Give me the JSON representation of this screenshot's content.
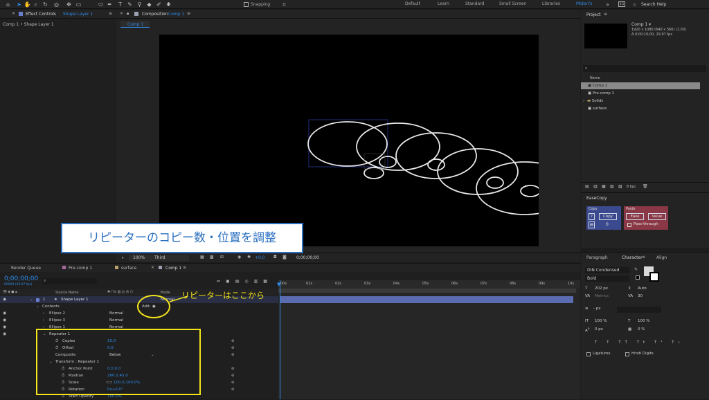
{
  "toolbar": {
    "snapping_label": "Snapping",
    "workspaces": [
      "Default",
      "Learn",
      "Standard",
      "Small Screen",
      "Libraries",
      "Midori's"
    ],
    "active_workspace": "Midori's",
    "search_placeholder": "Search Help"
  },
  "effect_controls": {
    "title": "Effect Controls",
    "layer": "Shape Layer 1",
    "breadcrumb": "Comp 1 • Shape Layer 1"
  },
  "composition": {
    "title": "Composition",
    "name": "Comp 1",
    "tab": "Comp 1",
    "zoom": "100%",
    "resolution": "Third",
    "exposure": "+0.0",
    "timecode": "0;00;00;00"
  },
  "overlay": {
    "banner": "リピーターのコピー数・位置を調整",
    "callout": "リピーターはここから"
  },
  "project": {
    "title": "Project",
    "comp_name": "Comp 1 ▾",
    "comp_info": [
      "1920 x 1080  (640 x 360) (1.00)",
      "Δ 0;00;10;00, 29.97 fps"
    ],
    "search_placeholder": "",
    "column_name": "Name",
    "items": [
      {
        "name": "Comp 1",
        "type": "comp",
        "selected": true
      },
      {
        "name": "Pre-comp 1",
        "type": "comp",
        "selected": false
      },
      {
        "name": "Solids",
        "type": "folder",
        "selected": false
      },
      {
        "name": "surface",
        "type": "comp",
        "selected": false
      }
    ],
    "bpc": "8 bpc"
  },
  "easecopy": {
    "title": "EaseCopy",
    "copy_group": "Copy",
    "copy_button": "Copy",
    "copy_value": "0",
    "paste_group": "Paste",
    "ease_button": "Ease",
    "value_button": "Value",
    "passthrough": "Pass-through"
  },
  "character": {
    "tabs": [
      "Paragraph",
      "Character",
      "Align"
    ],
    "active_tab": "Character",
    "font": "DIN Condensed",
    "style": "Bold",
    "size": "202 px",
    "leading": "Auto",
    "kerning": "Metrics",
    "tracking": "30",
    "stroke": "- px",
    "vscale": "100 %",
    "hscale": "100 %",
    "baseline": "0 px",
    "tsume": "0 %",
    "ligatures": "Ligatures",
    "hindi": "Hindi Digits"
  },
  "timeline": {
    "tabs": [
      "Render Queue",
      "Pre-comp 1",
      "surface",
      "Comp 1"
    ],
    "active_tab": "Comp 1",
    "timecode": "0;00;00;00",
    "fps": "00000 (29.97 fps)",
    "col_source": "Source Name",
    "col_mode": "Mode",
    "ruler": [
      "00s",
      "01s",
      "02s",
      "03s",
      "04s",
      "05s",
      "06s",
      "07s",
      "08s",
      "09s",
      "10s"
    ],
    "layer_number": "1",
    "layer_name": "Shape Layer 1",
    "layer_mode": "Normal",
    "contents": "Contents",
    "add_label": "Add:",
    "ellipses": [
      {
        "name": "Ellipse 2",
        "mode": "Normal"
      },
      {
        "name": "Ellipse 3",
        "mode": "Normal"
      },
      {
        "name": "Ellipse 1",
        "mode": "Normal"
      }
    ],
    "repeater": "Repeater 1",
    "copies_label": "Copies",
    "copies": "15.0",
    "offset_label": "Offset",
    "offset": "0.0",
    "composite_label": "Composite",
    "composite": "Below",
    "transform": "Transform : Repeater 1",
    "anchor_label": "Anchor Point",
    "anchor": "0.0,0.0",
    "position_label": "Position",
    "position": "260.0,45.0",
    "scale_label": "Scale",
    "scale": "100.0,100.0%",
    "rotation_label": "Rotation",
    "rotation": "0x+0.0°",
    "start_opacity_label": "Start Opacity",
    "start_opacity": "100.0%"
  },
  "colors": {
    "accent": "#2d8ceb",
    "highlight": "#f5e61b",
    "banner_border": "#2a6fc0",
    "layer_bar": "#5a6bb0"
  }
}
